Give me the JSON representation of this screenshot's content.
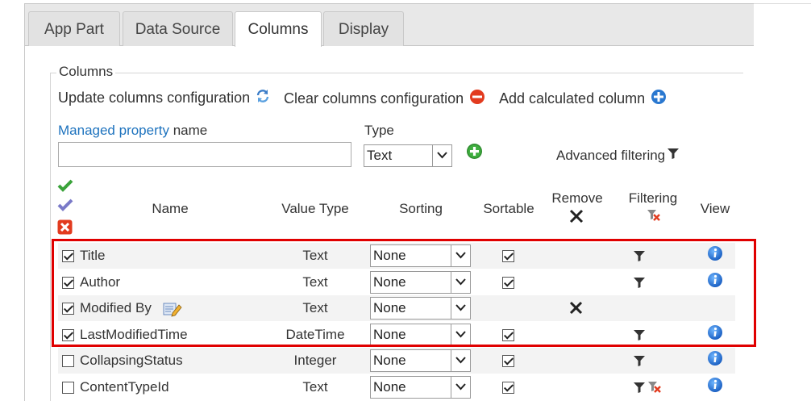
{
  "tabs": [
    {
      "label": "App Part",
      "active": false
    },
    {
      "label": "Data Source",
      "active": false
    },
    {
      "label": "Columns",
      "active": true
    },
    {
      "label": "Display",
      "active": false
    }
  ],
  "columns_section": {
    "legend": "Columns",
    "update_label": "Update columns configuration",
    "clear_label": "Clear columns configuration",
    "add_calc_label": "Add calculated column",
    "managed_property_link": "Managed property",
    "managed_property_suffix": " name",
    "managed_property_value": "",
    "type_label": "Type",
    "type_value": "Text",
    "advanced_filtering_label": "Advanced filtering"
  },
  "headers": {
    "name": "Name",
    "value_type": "Value Type",
    "sorting": "Sorting",
    "sortable": "Sortable",
    "remove": "Remove",
    "filtering": "Filtering",
    "view": "View"
  },
  "rows": [
    {
      "checked": true,
      "name": "Title",
      "edit_icon": false,
      "value_type": "Text",
      "sorting": "None",
      "sortable": true,
      "remove": false,
      "filter": "funnel",
      "view": true
    },
    {
      "checked": true,
      "name": "Author",
      "edit_icon": false,
      "value_type": "Text",
      "sorting": "None",
      "sortable": true,
      "remove": false,
      "filter": "funnel",
      "view": true
    },
    {
      "checked": true,
      "name": "Modified By",
      "edit_icon": true,
      "value_type": "Text",
      "sorting": "None",
      "sortable": false,
      "remove": true,
      "filter": "none",
      "view": false
    },
    {
      "checked": true,
      "name": "LastModifiedTime",
      "edit_icon": false,
      "value_type": "DateTime",
      "sorting": "None",
      "sortable": true,
      "remove": false,
      "filter": "funnel",
      "view": true
    },
    {
      "checked": false,
      "name": "CollapsingStatus",
      "edit_icon": false,
      "value_type": "Integer",
      "sorting": "None",
      "sortable": true,
      "remove": false,
      "filter": "funnel",
      "view": true
    },
    {
      "checked": false,
      "name": "ContentTypeId",
      "edit_icon": false,
      "value_type": "Text",
      "sorting": "None",
      "sortable": true,
      "remove": false,
      "filter": "funnel-clear",
      "view": true
    }
  ],
  "colors": {
    "highlight": "#e00000",
    "link": "#1e73be",
    "info_icon": "#1a73d6",
    "clear_icon": "#e23b1f",
    "add_icon": "#2f8c2f"
  },
  "icons": {
    "update": "refresh-icon",
    "clear": "minus-circle-icon",
    "add_calc": "plus-circle-icon",
    "add_column": "green-plus-icon",
    "advanced_filter": "funnel-icon",
    "select_all": "green-check-icon",
    "select_toggle": "purple-check-icon",
    "select_none": "red-x-icon",
    "remove_header": "x-icon",
    "filtering_header": "funnel-clear-icon",
    "view": "info-icon",
    "edit": "edit-pencil-icon"
  }
}
